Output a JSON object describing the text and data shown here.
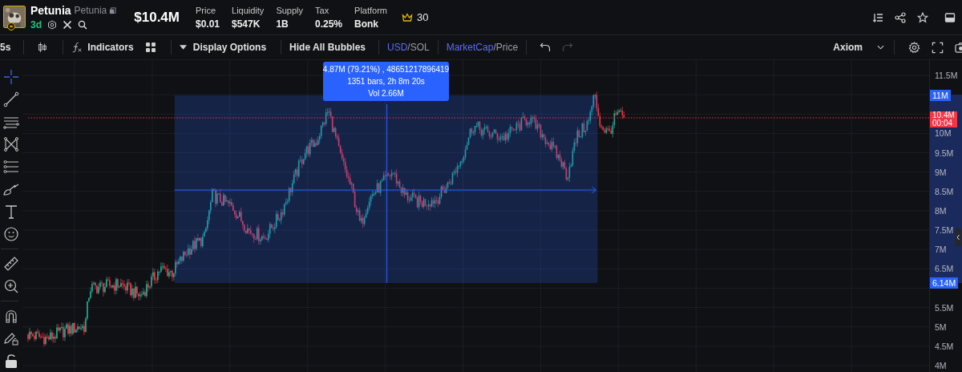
{
  "token": {
    "name": "Petunia",
    "ticker": "Petunia",
    "age": "3d",
    "market_cap": "$10.4M"
  },
  "stats": [
    {
      "label": "Price",
      "value": "$0.01"
    },
    {
      "label": "Liquidity",
      "value": "$547K"
    },
    {
      "label": "Supply",
      "value": "1B"
    },
    {
      "label": "Tax",
      "value": "0.25%"
    },
    {
      "label": "Platform",
      "value": "Bonk"
    }
  ],
  "crown_count": "30",
  "toolbar": {
    "interval": "5s",
    "indicators": "Indicators",
    "display_options": "Display Options",
    "hide_bubbles": "Hide All Bubbles",
    "currency": [
      {
        "label": "USD",
        "selected": true
      },
      {
        "label": "SOL",
        "selected": false
      }
    ],
    "metric": [
      {
        "label": "MarketCap",
        "selected": true
      },
      {
        "label": "Price",
        "selected": false
      }
    ],
    "separator": "/",
    "redo_disabled": true,
    "layout": "Axiom"
  },
  "measure": {
    "lines": [
      "4.87M (79.21%) , 48651217896419",
      "1351 bars, 2h 8m 20s",
      "Vol 2.66M"
    ]
  },
  "price_axis": {
    "ticks": [
      "11.5M",
      "10M",
      "9.5M",
      "9M",
      "8.5M",
      "8M",
      "7.5M",
      "7M",
      "6.5M",
      "5.5M",
      "5M",
      "4.5M",
      "4M"
    ],
    "range_high": "11M",
    "range_low": "6.14M",
    "last_price": "10.4M",
    "countdown": "00:04"
  }
}
